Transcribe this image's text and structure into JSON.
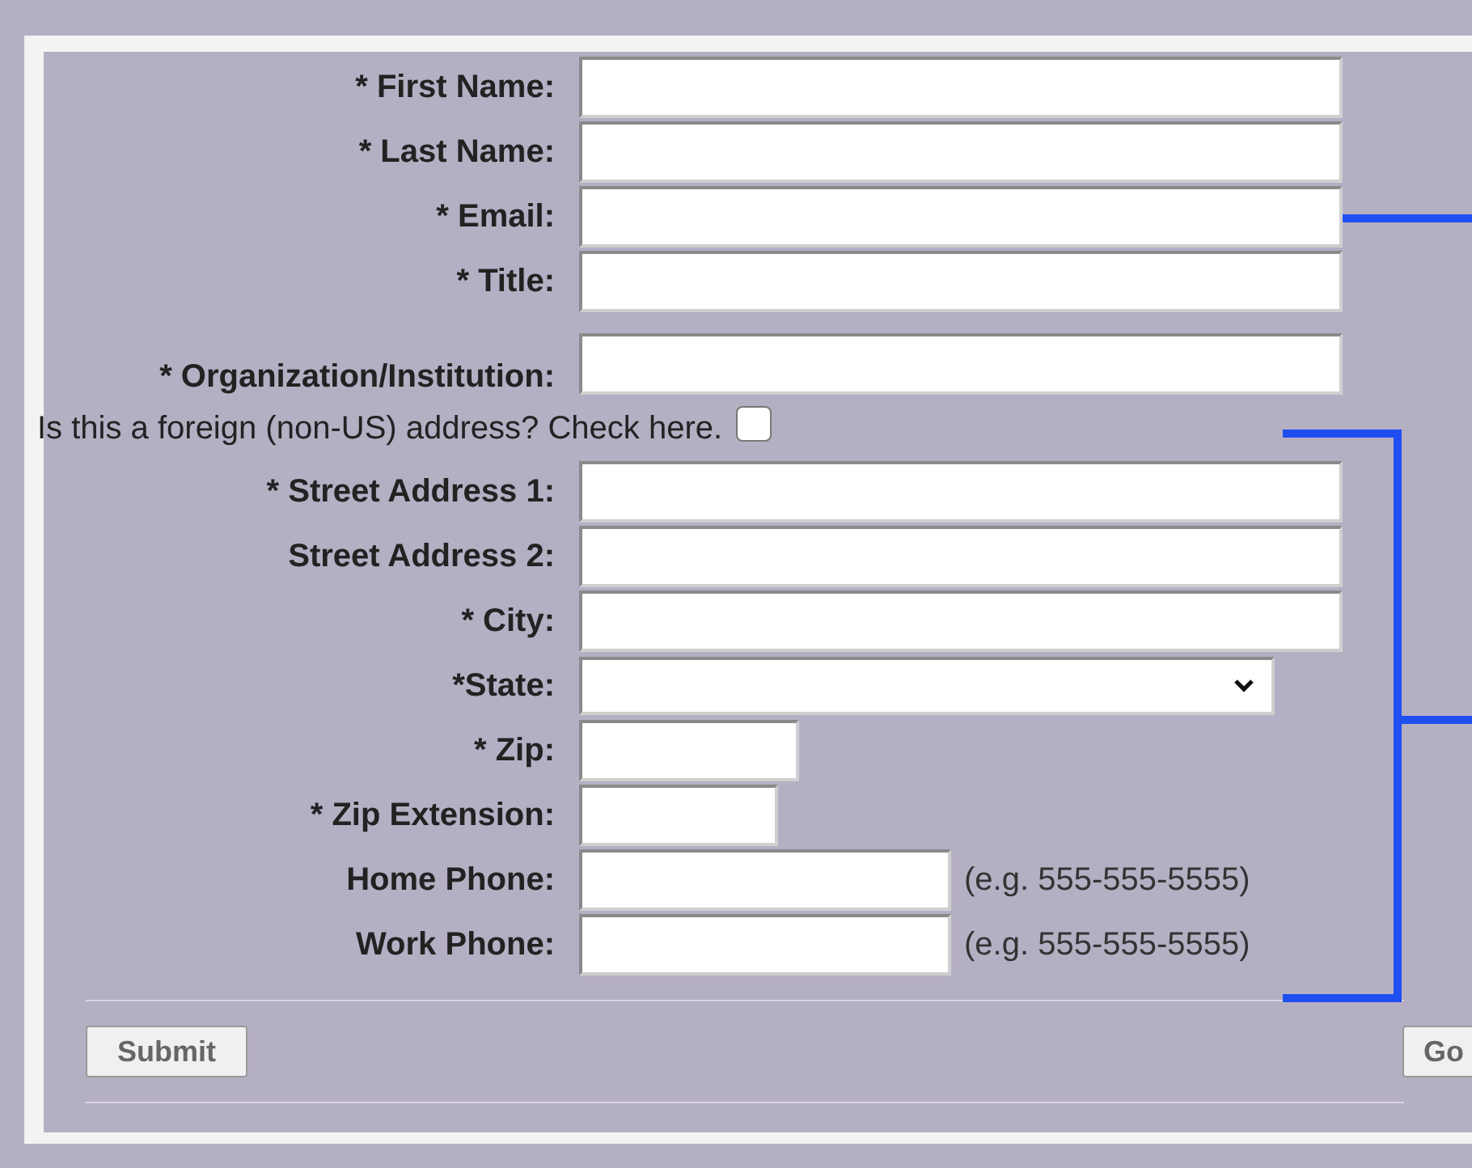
{
  "fields": [
    {
      "label": "* First Name:",
      "kind": "wide"
    },
    {
      "label": "* Last Name:",
      "kind": "wide"
    },
    {
      "label": "* Email:",
      "kind": "wide"
    },
    {
      "label": "* Title:",
      "kind": "wide"
    },
    {
      "label": "* Organization/Institution:",
      "kind": "wide_tall"
    }
  ],
  "foreign": {
    "label": "Is this a foreign (non-US) address? Check here.",
    "checked": false
  },
  "address_fields": [
    {
      "label": "* Street Address 1:",
      "kind": "wide"
    },
    {
      "label": "Street Address 2:",
      "kind": "wide"
    },
    {
      "label": "* City:",
      "kind": "wide"
    },
    {
      "label": "*State:",
      "kind": "select"
    },
    {
      "label": "* Zip:",
      "kind": "zip"
    },
    {
      "label": "* Zip Extension:",
      "kind": "zip_ext"
    },
    {
      "label": "Home Phone:",
      "kind": "phone",
      "hint": "(e.g. 555-555-5555)"
    },
    {
      "label": "Work Phone:",
      "kind": "phone",
      "hint": "(e.g. 555-555-5555)"
    }
  ],
  "buttons": [
    "Submit",
    "Go"
  ]
}
